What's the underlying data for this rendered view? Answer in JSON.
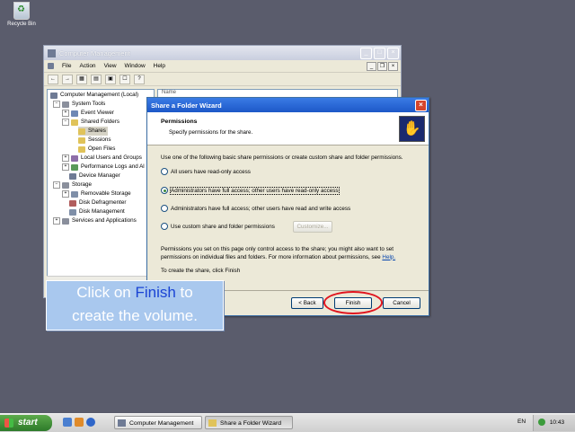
{
  "desktop": {
    "recycle_bin": "Recycle Bin"
  },
  "cm_window": {
    "title": "Computer Management",
    "menu": [
      "File",
      "Action",
      "View",
      "Window",
      "Help"
    ],
    "tree": [
      "Computer Management (Local)",
      "System Tools",
      "Event Viewer",
      "Shared Folders",
      "Shares",
      "Sessions",
      "Open Files",
      "Local Users and Groups",
      "Performance Logs and Al",
      "Device Manager",
      "Storage",
      "Removable Storage",
      "Disk Defragmenter",
      "Disk Management",
      "Services and Applications"
    ],
    "right_header": "Name"
  },
  "wizard": {
    "title": "Share a Folder Wizard",
    "heading": "Permissions",
    "subheading": "Specify permissions for the share.",
    "intro": "Use one of the following basic share permissions or create custom share and folder permissions.",
    "options": [
      "All users have read-only access",
      "Administrators have full access; other users have read-only access",
      "Administrators have full access; other users have read and write access",
      "Use custom share and folder permissions"
    ],
    "selected_option": 1,
    "customize_label": "Customize...",
    "info_text": "Permissions you set on this page only control access to the share; you might also want to set permissions on individual files and folders. For more information about permissions, see",
    "help_link": "Help.",
    "finish_note": "To create the share, click Finish",
    "back_label": "< Back",
    "finish_label": "Finish",
    "cancel_label": "Cancel"
  },
  "callout": {
    "part1": "Click on ",
    "highlight": "Finish",
    "part2": " to",
    "line2": "create the volume."
  },
  "taskbar": {
    "start": "start",
    "tasks": [
      "Computer Management",
      "Share a Folder Wizard"
    ],
    "lang": "EN",
    "time": "10:43"
  }
}
